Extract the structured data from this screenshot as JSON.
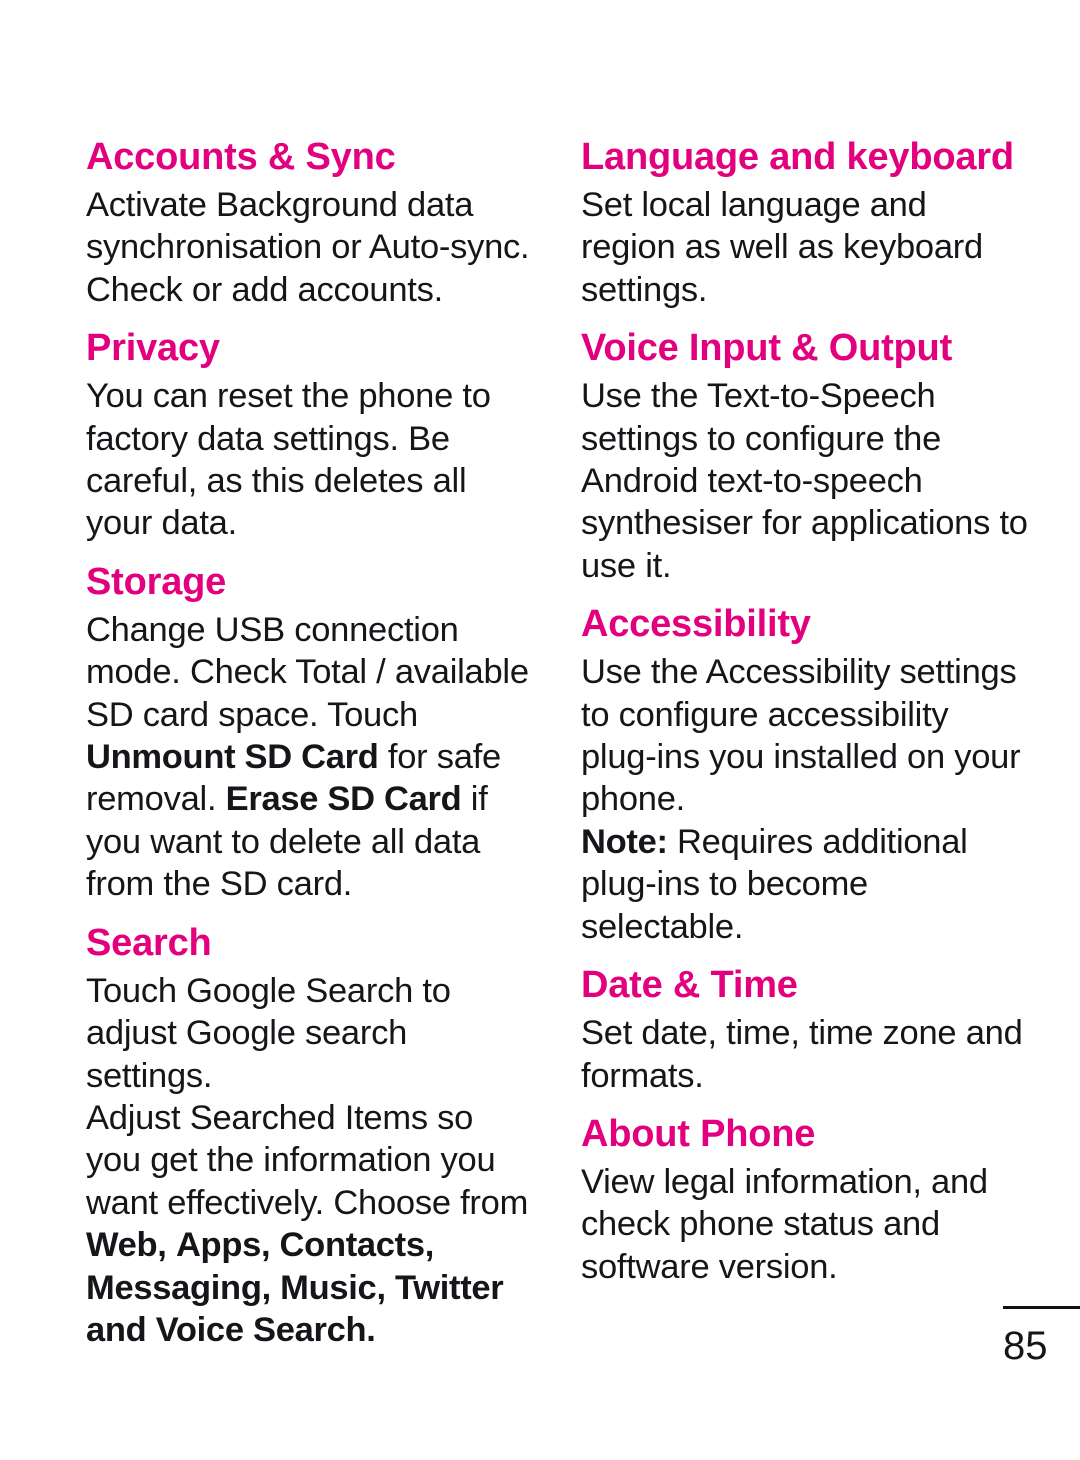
{
  "document": {
    "page_number": "85",
    "accent_color": "#e2007e",
    "text_color": "#16161a"
  },
  "left_column": {
    "sections": [
      {
        "heading": "Accounts & Sync",
        "paragraphs": [
          "Activate Background data synchronisation or Auto-sync. Check or add accounts."
        ]
      },
      {
        "heading": "Privacy",
        "paragraphs": [
          "You can reset the phone to factory data settings. Be careful, as this deletes all your data."
        ]
      },
      {
        "heading": "Storage",
        "paragraphs": [
          {
            "runs": [
              {
                "text": "Change USB connection mode. Check Total / available SD card space. Touch ",
                "bold": false
              },
              {
                "text": "Unmount SD Card",
                "bold": true
              },
              {
                "text": " for safe removal. ",
                "bold": false
              },
              {
                "text": "Erase SD Card",
                "bold": true
              },
              {
                "text": " if you want to delete all data from the SD card.",
                "bold": false
              }
            ]
          }
        ]
      },
      {
        "heading": "Search",
        "paragraphs": [
          "Touch Google Search to adjust Google search settings.",
          {
            "runs": [
              {
                "text": "Adjust Searched Items so you get the information you want effectively. Choose from ",
                "bold": false
              },
              {
                "text": "Web,",
                "bold": true
              },
              {
                "text": " ",
                "bold": false
              },
              {
                "text": "Apps, Contacts, Messaging, Music, Twitter and Voice Search.",
                "bold": true
              }
            ]
          }
        ]
      }
    ]
  },
  "right_column": {
    "sections": [
      {
        "heading": "Language and keyboard",
        "paragraphs": [
          "Set local language and region as well as keyboard settings."
        ]
      },
      {
        "heading": "Voice Input & Output",
        "paragraphs": [
          "Use the Text-to-Speech settings to configure the Android text-to-speech synthesiser for applications to use it."
        ]
      },
      {
        "heading": "Accessibility",
        "paragraphs": [
          "Use the Accessibility settings to configure accessibility plug-ins you installed on your phone.",
          {
            "runs": [
              {
                "text": "Note:",
                "bold": true
              },
              {
                "text": " Requires additional plug-ins to become selectable.",
                "bold": false
              }
            ]
          }
        ]
      },
      {
        "heading": "Date & Time",
        "paragraphs": [
          "Set date, time, time zone and formats."
        ]
      },
      {
        "heading": "About Phone",
        "paragraphs": [
          "View legal information, and check phone status and software version."
        ]
      }
    ]
  }
}
